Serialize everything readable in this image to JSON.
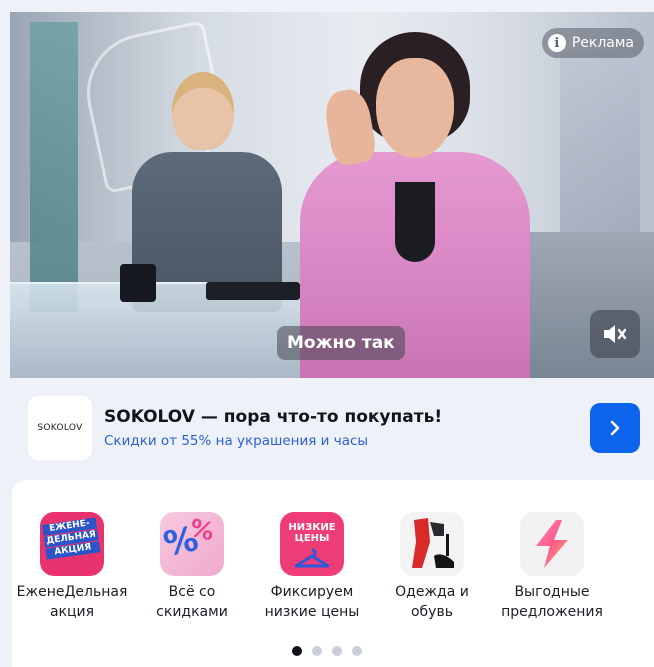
{
  "ad": {
    "badge_label": "Реклама",
    "caption": "Можно так",
    "brand_logo_text": "SOKOLOV",
    "title": "SOKOLOV — пора что-то покупать!",
    "subtitle": "Скидки от 55% на украшения и часы",
    "mute_icon": "speaker-muted-icon",
    "go_icon": "chevron-right-icon"
  },
  "categories": {
    "items": [
      {
        "label_line1": "ЕженеДельная",
        "label_line2": "акция",
        "tile_text": [
          "ЕЖЕНЕ-",
          "ДЕЛЬНАЯ",
          "АКЦИЯ"
        ]
      },
      {
        "label_line1": "Всё со",
        "label_line2": "скидками"
      },
      {
        "label_line1": "Фиксируем",
        "label_line2": "низкие цены",
        "tile_text": [
          "НИЗКИЕ",
          "ЦЕНЫ"
        ]
      },
      {
        "label_line1": "Одежда и",
        "label_line2": "обувь"
      },
      {
        "label_line1": "Выгодные",
        "label_line2": "предложения"
      }
    ],
    "pager": {
      "count": 4,
      "active_index": 0
    }
  },
  "colors": {
    "accent_blue": "#0d64ec",
    "link_blue": "#2a61d6",
    "promo_pink": "#ee3c78"
  }
}
